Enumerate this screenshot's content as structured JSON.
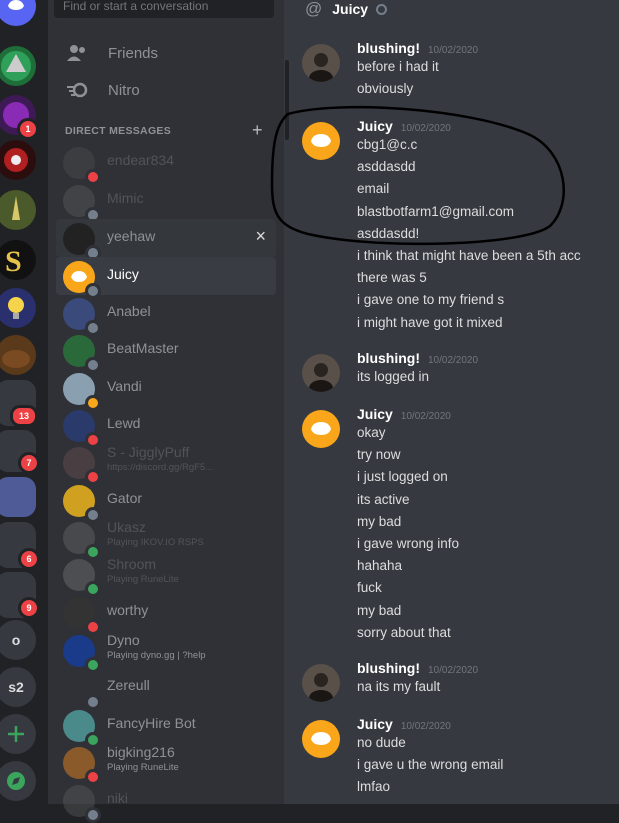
{
  "search": {
    "placeholder": "Find or start a conversation"
  },
  "nav": [
    {
      "label": "Friends",
      "icon": "friends-icon"
    },
    {
      "label": "Nitro",
      "icon": "nitro-icon"
    }
  ],
  "dm_header": "DIRECT MESSAGES",
  "guild_badges": [
    "1",
    "13",
    "7",
    "6",
    "9"
  ],
  "guild_text": [
    "o",
    "s2"
  ],
  "dms": [
    {
      "name": "endear834",
      "sub": "",
      "state": "faded",
      "status": "dnd"
    },
    {
      "name": "Mimic",
      "sub": "",
      "state": "faded",
      "status": "offline"
    },
    {
      "name": "yeehaw",
      "sub": "",
      "state": "hover",
      "status": "offline"
    },
    {
      "name": "Juicy",
      "sub": "",
      "state": "active",
      "status": "offline"
    },
    {
      "name": "Anabel",
      "sub": "",
      "state": "normal",
      "status": "offline"
    },
    {
      "name": "BeatMaster",
      "sub": "",
      "state": "normal",
      "status": "offline"
    },
    {
      "name": "Vandi",
      "sub": "",
      "state": "normal",
      "status": "idle"
    },
    {
      "name": "Lewd",
      "sub": "",
      "state": "normal",
      "status": "dnd"
    },
    {
      "name": "S - JigglyPuff",
      "sub": "https://discord.gg/RgF5...",
      "state": "faded",
      "status": "dnd"
    },
    {
      "name": "Gator",
      "sub": "",
      "state": "normal",
      "status": "offline"
    },
    {
      "name": "Ukasz",
      "sub": "Playing IKOV.IO RSPS",
      "state": "faded",
      "status": "online"
    },
    {
      "name": "Shroom",
      "sub": "Playing RuneLite",
      "state": "faded",
      "status": "online"
    },
    {
      "name": "worthy",
      "sub": "",
      "state": "normal",
      "status": "dnd"
    },
    {
      "name": "Dyno",
      "sub": "Playing dyno.gg | ?help",
      "state": "normal",
      "status": "online"
    },
    {
      "name": "Zereull",
      "sub": "",
      "state": "normal",
      "status": "offline"
    },
    {
      "name": "FancyHire Bot",
      "sub": "",
      "state": "normal",
      "status": "online"
    },
    {
      "name": "bigking216",
      "sub": "Playing RuneLite",
      "state": "normal",
      "status": "dnd"
    },
    {
      "name": "niki",
      "sub": "",
      "state": "faded",
      "status": "offline"
    }
  ],
  "channel": {
    "name": "Juicy",
    "icon": "at-icon"
  },
  "messages": [
    {
      "author": "blushing!",
      "time": "10/02/2020",
      "lines": [
        "before i had it",
        "obviously"
      ]
    },
    {
      "author": "Juicy",
      "time": "10/02/2020",
      "lines": [
        "cbg1@c.c",
        "asddasdd",
        "email",
        "blastbotfarm1@gmail.com",
        "asddasdd!",
        "i think that might have been a 5th acc",
        "there was 5",
        "i gave one to my friend s",
        "i might have got it mixed"
      ]
    },
    {
      "author": "blushing!",
      "time": "10/02/2020",
      "lines": [
        "its logged in"
      ]
    },
    {
      "author": "Juicy",
      "time": "10/02/2020",
      "lines": [
        "okay",
        "try now",
        "i just logged on",
        "its active",
        "my bad",
        "i gave wrong info",
        "hahaha",
        "fuck",
        "my bad",
        "sorry about that"
      ]
    },
    {
      "author": "blushing!",
      "time": "10/02/2020",
      "lines": [
        "na its my fault"
      ]
    },
    {
      "author": "Juicy",
      "time": "10/02/2020",
      "lines": [
        "no dude",
        "i gave u the wrong email",
        "lmfao"
      ]
    }
  ]
}
